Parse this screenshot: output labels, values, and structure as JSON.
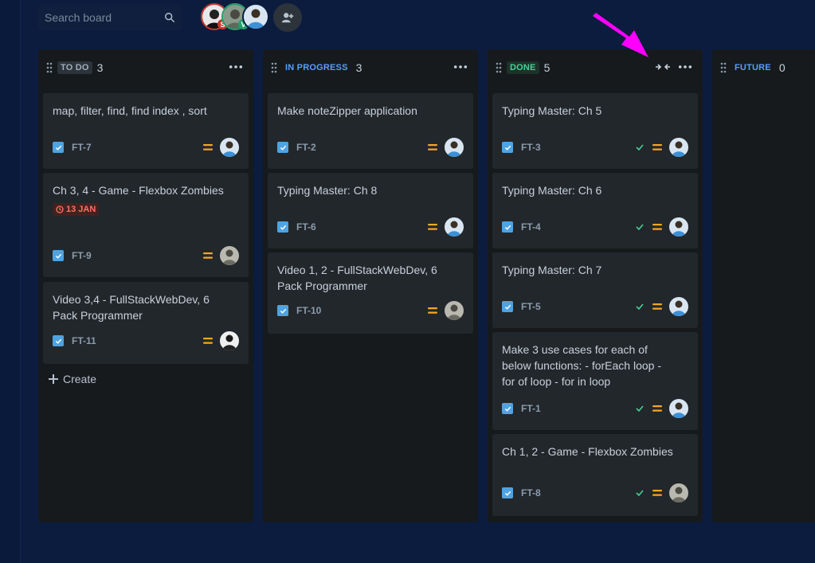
{
  "search": {
    "placeholder": "Search board"
  },
  "people": [
    {
      "initial": "S",
      "badge_color": "#c9372c",
      "ring": "#c9372c"
    },
    {
      "initial": "V",
      "badge_color": "#22a06b",
      "ring": "#22a06b"
    },
    {
      "initial": "",
      "badge_color": "#579dff",
      "ring": "#0b1c3f"
    }
  ],
  "colors": {
    "background": "#0b1c3f",
    "column": "#161a1d",
    "card": "#22272b",
    "accent": "#579dff",
    "priority": "#f5a623",
    "done": "#4bce97",
    "pointer": "#ff00ff"
  },
  "columns": [
    {
      "name": "TO DO",
      "count": "3",
      "lozenge_bg": "#2c333a",
      "lozenge_fg": "#9fadbc",
      "cards": [
        {
          "title": "map, filter, find, find index , sort",
          "key": "FT-7",
          "done": false,
          "avatar": "blue"
        },
        {
          "title": "Ch 3, 4 - Game - Flexbox Zombies",
          "key": "FT-9",
          "done": false,
          "due": "13 JAN",
          "avatar": "grey"
        },
        {
          "title": "Video 3,4 - FullStackWebDev, 6 Pack Programmer",
          "key": "FT-11",
          "done": false,
          "avatar": "bw"
        }
      ],
      "create_label": "Create"
    },
    {
      "name": "IN PROGRESS",
      "count": "3",
      "lozenge_bg": "#161a1d",
      "lozenge_fg": "#579dff",
      "cards": [
        {
          "title": "Make noteZipper application",
          "key": "FT-2",
          "done": false,
          "avatar": "blue"
        },
        {
          "title": "Typing Master: Ch 8",
          "key": "FT-6",
          "done": false,
          "avatar": "blue"
        },
        {
          "title": "Video 1, 2 - FullStackWebDev, 6 Pack Programmer",
          "key": "FT-10",
          "done": false,
          "avatar": "grey"
        }
      ]
    },
    {
      "name": "DONE",
      "count": "5",
      "lozenge_bg": "#1c3329",
      "lozenge_fg": "#4bce97",
      "cards": [
        {
          "title": "Typing Master: Ch 5",
          "key": "FT-3",
          "done": true,
          "avatar": "blue"
        },
        {
          "title": "Typing Master: Ch 6",
          "key": "FT-4",
          "done": true,
          "avatar": "blue"
        },
        {
          "title": "Typing Master: Ch 7",
          "key": "FT-5",
          "done": true,
          "avatar": "blue"
        },
        {
          "title": "Make 3 use cases for each of below functions: - forEach loop - for of loop - for in loop",
          "key": "FT-1",
          "done": true,
          "avatar": "blue"
        },
        {
          "title": "Ch 1, 2 - Game - Flexbox Zombies",
          "key": "FT-8",
          "done": true,
          "avatar": "grey"
        }
      ]
    },
    {
      "name": "FUTURE",
      "count": "0",
      "lozenge_bg": "#161a1d",
      "lozenge_fg": "#579dff",
      "cards": []
    }
  ]
}
